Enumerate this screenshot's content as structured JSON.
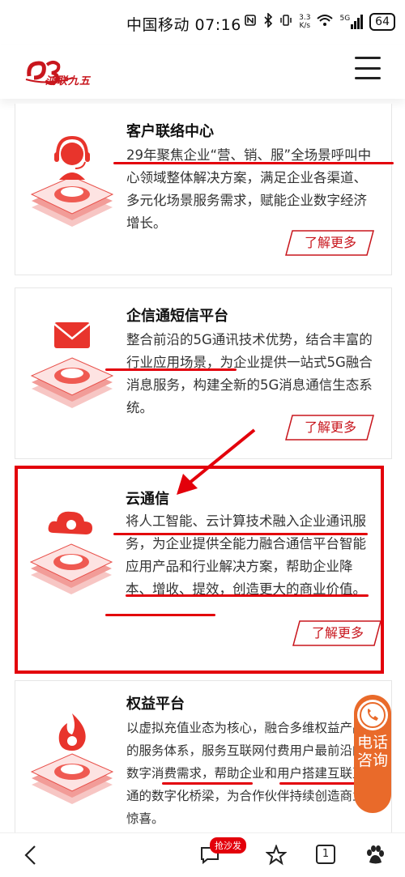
{
  "status_bar": {
    "carrier_time": "中国移动 07:16",
    "net_speed_value": "3.3",
    "net_speed_unit": "K/s",
    "signal_label": "5G",
    "battery": "64"
  },
  "header": {
    "logo_text": "鸿联九五"
  },
  "cards": [
    {
      "title": "客户联络中心",
      "desc": "29年聚焦企业“营、销、服”全场景呼叫中心领域整体解决方案，满足企业各渠道、多元化场景服务需求，赋能企业数字经济增长。",
      "button": "了解更多",
      "icon": "headset-icon"
    },
    {
      "title": "企信通短信平台",
      "desc": "整合前沿的5G通讯技术优势，结合丰富的行业应用场景，为企业提供一站式5G融合消息服务，构建全新的5G消息通信生态系统。",
      "button": "了解更多",
      "icon": "envelope-icon"
    },
    {
      "title": "云通信",
      "desc": "将人工智能、云计算技术融入企业通讯服务，为企业提供全能力融合通信平台智能应用产品和行业解决方案，帮助企业降本、增收、提效，创造更大的商业价值。",
      "button": "了解更多",
      "icon": "cloud-icon"
    },
    {
      "title": "权益平台",
      "desc": "以虚拟充值业态为核心，融合多维权益产品的服务体系，服务互联网付费用户最前沿的数字消费需求，帮助企业和用户搭建互联互通的数字化桥梁，为合作伙伴持续创造商业惊喜。",
      "button": "",
      "icon": "flame-icon"
    }
  ],
  "float_consult": {
    "label": "电话咨询"
  },
  "bottom_bar": {
    "badge": "抢沙发",
    "tab_count": "1"
  },
  "colors": {
    "accent": "#c8161d",
    "annotation": "#e3000b",
    "consult": "#e96a2a"
  }
}
